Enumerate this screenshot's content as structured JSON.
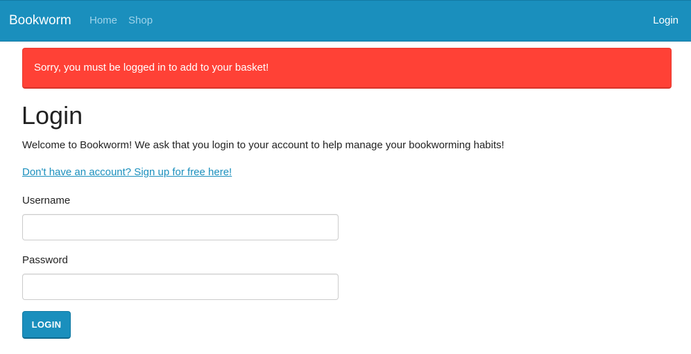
{
  "navbar": {
    "brand": "Bookworm",
    "links": [
      {
        "label": "Home"
      },
      {
        "label": "Shop"
      }
    ],
    "login_label": "Login",
    "background_color": "#1a8fbd"
  },
  "alert": {
    "message": "Sorry, you must be logged in to add to your basket!",
    "background_color": "#ff4136"
  },
  "main": {
    "title": "Login",
    "intro": "Welcome to Bookworm! We ask that you login to your account to help manage your bookworming habits!",
    "signup_link": "Don't have an account? Sign up for free here!",
    "form": {
      "username_label": "Username",
      "username_value": "",
      "password_label": "Password",
      "password_value": "",
      "submit_label": "Login"
    }
  }
}
